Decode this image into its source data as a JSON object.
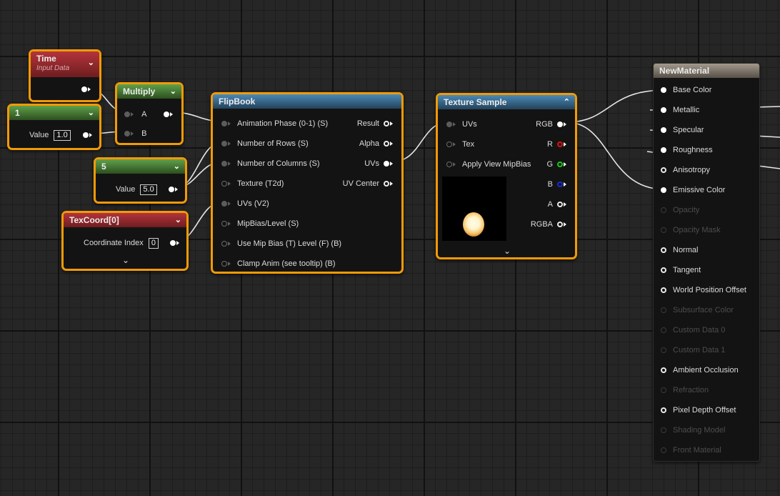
{
  "nodes": {
    "time": {
      "title": "Time",
      "subtitle": "Input Data"
    },
    "const1": {
      "title": "1",
      "value_label": "Value",
      "value": "1.0"
    },
    "multiply": {
      "title": "Multiply",
      "pin_a": "A",
      "pin_b": "B"
    },
    "const5": {
      "title": "5",
      "value_label": "Value",
      "value": "5.0"
    },
    "texcoord": {
      "title": "TexCoord[0]",
      "index_label": "Coordinate Index",
      "index_value": "0"
    },
    "flipbook": {
      "title": "FlipBook",
      "inputs": [
        "Animation  Phase (0-1) (S)",
        "Number of Rows (S)",
        "Number of Columns (S)",
        "Texture (T2d)",
        "UVs (V2)",
        "MipBias/Level (S)",
        "Use Mip Bias (T) Level (F) (B)",
        "Clamp Anim (see tooltip) (B)"
      ],
      "outputs": [
        "Result",
        "Alpha",
        "UVs",
        "UV Center"
      ]
    },
    "texture_sample": {
      "title": "Texture Sample",
      "inputs": [
        "UVs",
        "Tex",
        "Apply View MipBias"
      ],
      "outputs": [
        "RGB",
        "R",
        "G",
        "B",
        "A",
        "RGBA"
      ]
    },
    "material": {
      "title": "NewMaterial",
      "inputs": [
        {
          "label": "Base Color",
          "enabled": true
        },
        {
          "label": "Metallic",
          "enabled": true
        },
        {
          "label": "Specular",
          "enabled": true
        },
        {
          "label": "Roughness",
          "enabled": true
        },
        {
          "label": "Anisotropy",
          "enabled": true
        },
        {
          "label": "Emissive Color",
          "enabled": true
        },
        {
          "label": "Opacity",
          "enabled": false
        },
        {
          "label": "Opacity Mask",
          "enabled": false
        },
        {
          "label": "Normal",
          "enabled": true
        },
        {
          "label": "Tangent",
          "enabled": true
        },
        {
          "label": "World Position Offset",
          "enabled": true
        },
        {
          "label": "Subsurface Color",
          "enabled": false
        },
        {
          "label": "Custom Data 0",
          "enabled": false
        },
        {
          "label": "Custom Data 1",
          "enabled": false
        },
        {
          "label": "Ambient Occlusion",
          "enabled": true
        },
        {
          "label": "Refraction",
          "enabled": false
        },
        {
          "label": "Pixel Depth Offset",
          "enabled": true
        },
        {
          "label": "Shading Model",
          "enabled": false
        },
        {
          "label": "Front Material",
          "enabled": false
        }
      ]
    }
  },
  "icons": {
    "collapse": "chevron-down-icon",
    "expand": "chevron-up-icon"
  },
  "colors": {
    "selection": "#f29a06",
    "wire": "#e8e8e8",
    "red_pin": "#e01010",
    "green_pin": "#10d010",
    "blue_pin": "#1a2ad8"
  }
}
